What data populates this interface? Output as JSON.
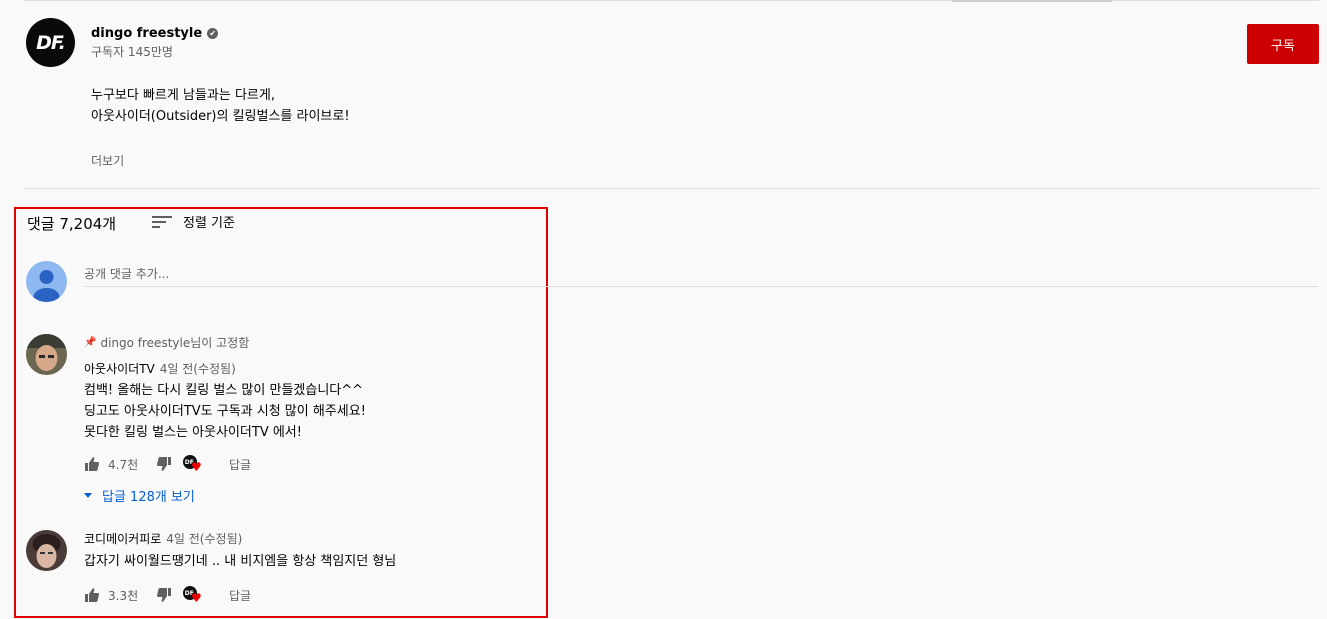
{
  "channel": {
    "logo_text": "DF.",
    "name": "dingo freestyle",
    "verified_mark": "✔",
    "subscribers": "구독자 145만명",
    "subscribe_label": "구독"
  },
  "description": {
    "lines": [
      "누구보다 빠르게 남들과는 다르게,",
      "아웃사이더(Outsider)의 킬링벌스를 라이브로!"
    ],
    "more_label": "더보기"
  },
  "comments_header": {
    "count": "댓글 7,204개",
    "sort_label": "정렬 기준"
  },
  "add_comment": {
    "placeholder": "공개 댓글 추가..."
  },
  "comments": [
    {
      "pinned_by": "dingo freestyle님이 고정함",
      "author": "아웃사이더TV",
      "time": "4일 전(수정됨)",
      "lines": [
        "컴백! 올해는 다시 킬링 벌스 많이 만들겠습니다^^",
        "딩고도 아웃사이더TV도 구독과 시청 많이 해주세요!",
        "못다한 킬링 벌스는 아웃사이더TV 에서!"
      ],
      "likes": "4.7천",
      "reply_label": "답글",
      "view_replies": "답글 128개 보기"
    },
    {
      "author": "코디메이커피로",
      "time": "4일 전(수정됨)",
      "lines": [
        "갑자기 싸이월드땡기네 ..  내 비지엠을 항상 책임지던 형님"
      ],
      "likes": "3.3천",
      "reply_label": "답글"
    }
  ],
  "colors": {
    "subscribe": "#cc0000",
    "highlight_box": "#e00000",
    "link": "#065fd4",
    "heart": "#ee0000"
  }
}
